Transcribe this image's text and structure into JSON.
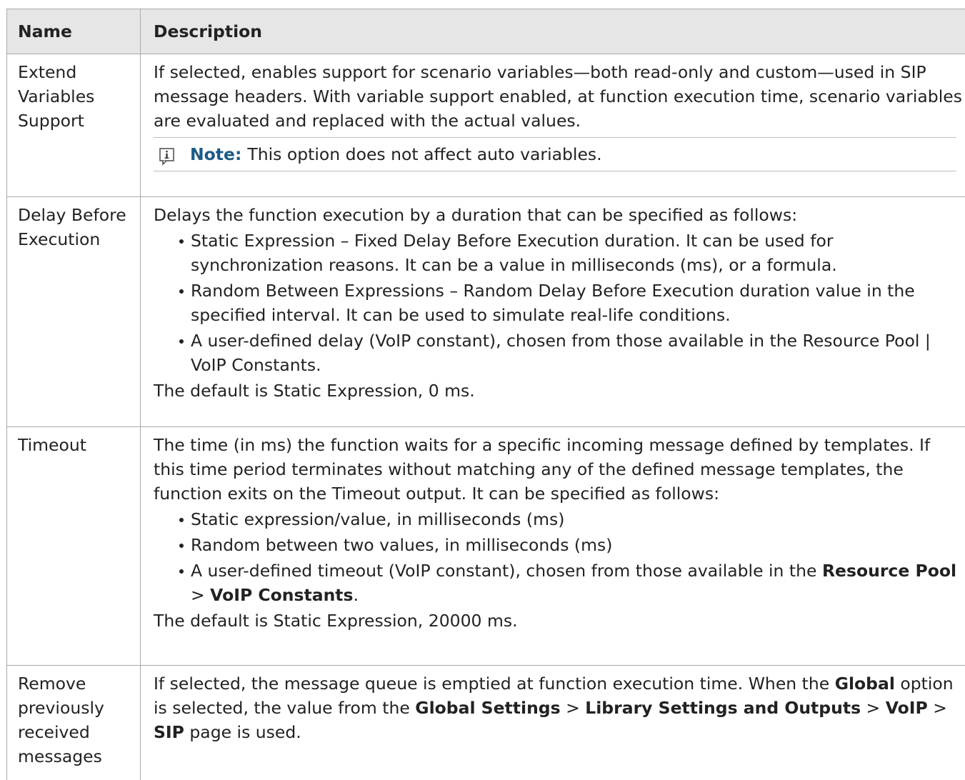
{
  "header": {
    "name": "Name",
    "description": "Description"
  },
  "rows": [
    {
      "name": "Extend Variables Support",
      "para": "If selected, enables support for scenario variables—both read-only and custom—used in SIP message headers. With variable support enabled, at function execution time, scenario variables are evaluated and replaced with the actual values.",
      "note": {
        "icon": "info-note-icon",
        "label": "Note:",
        "text": "This option does not affect auto variables."
      }
    },
    {
      "name": "Delay Before Execution",
      "intro": "Delays the function execution by a duration that can be specified as follows:",
      "bullets": [
        "Static Expression – Fixed Delay Before Execution duration. It can be used for synchronization reasons. It can be a value in milliseconds (ms), or a formula.",
        "Random Between Expressions – Random Delay Before Execution duration value in the specified interval. It can be used to simulate real-life conditions.",
        "A user-defined delay (VoIP constant), chosen from those available in the Resource Pool | VoIP Constants."
      ],
      "footer": "The default is Static Expression, 0 ms."
    },
    {
      "name": "Timeout",
      "intro": "The time (in ms) the function waits for a specific incoming message defined by templates. If this time period terminates without matching any of the defined message templates, the function exits on the Timeout output. It can be specified as follows:",
      "bullets": [
        "Static expression/value, in milliseconds (ms)",
        "Random between two values, in milliseconds (ms)"
      ],
      "bullet3": {
        "prefix": "A user-defined timeout (VoIP constant), chosen from those available in the ",
        "bold1": "Resource Pool",
        "sep": " > ",
        "bold2": "VoIP Constants",
        "suffix": "."
      },
      "footer": "The default is Static Expression, 20000 ms."
    },
    {
      "name": "Remove previously received messages",
      "part1": "If selected, the message queue is emptied at function execution time. When the ",
      "bold1": "Global",
      "part2": " option is selected, the value from the ",
      "bold2": "Global Settings",
      "sep1": " > ",
      "bold3": "Library Settings and Outputs",
      "sep2": " > ",
      "bold4": "VoIP",
      "sep3": " > ",
      "bold5": "SIP",
      "part3": " page is used."
    }
  ]
}
